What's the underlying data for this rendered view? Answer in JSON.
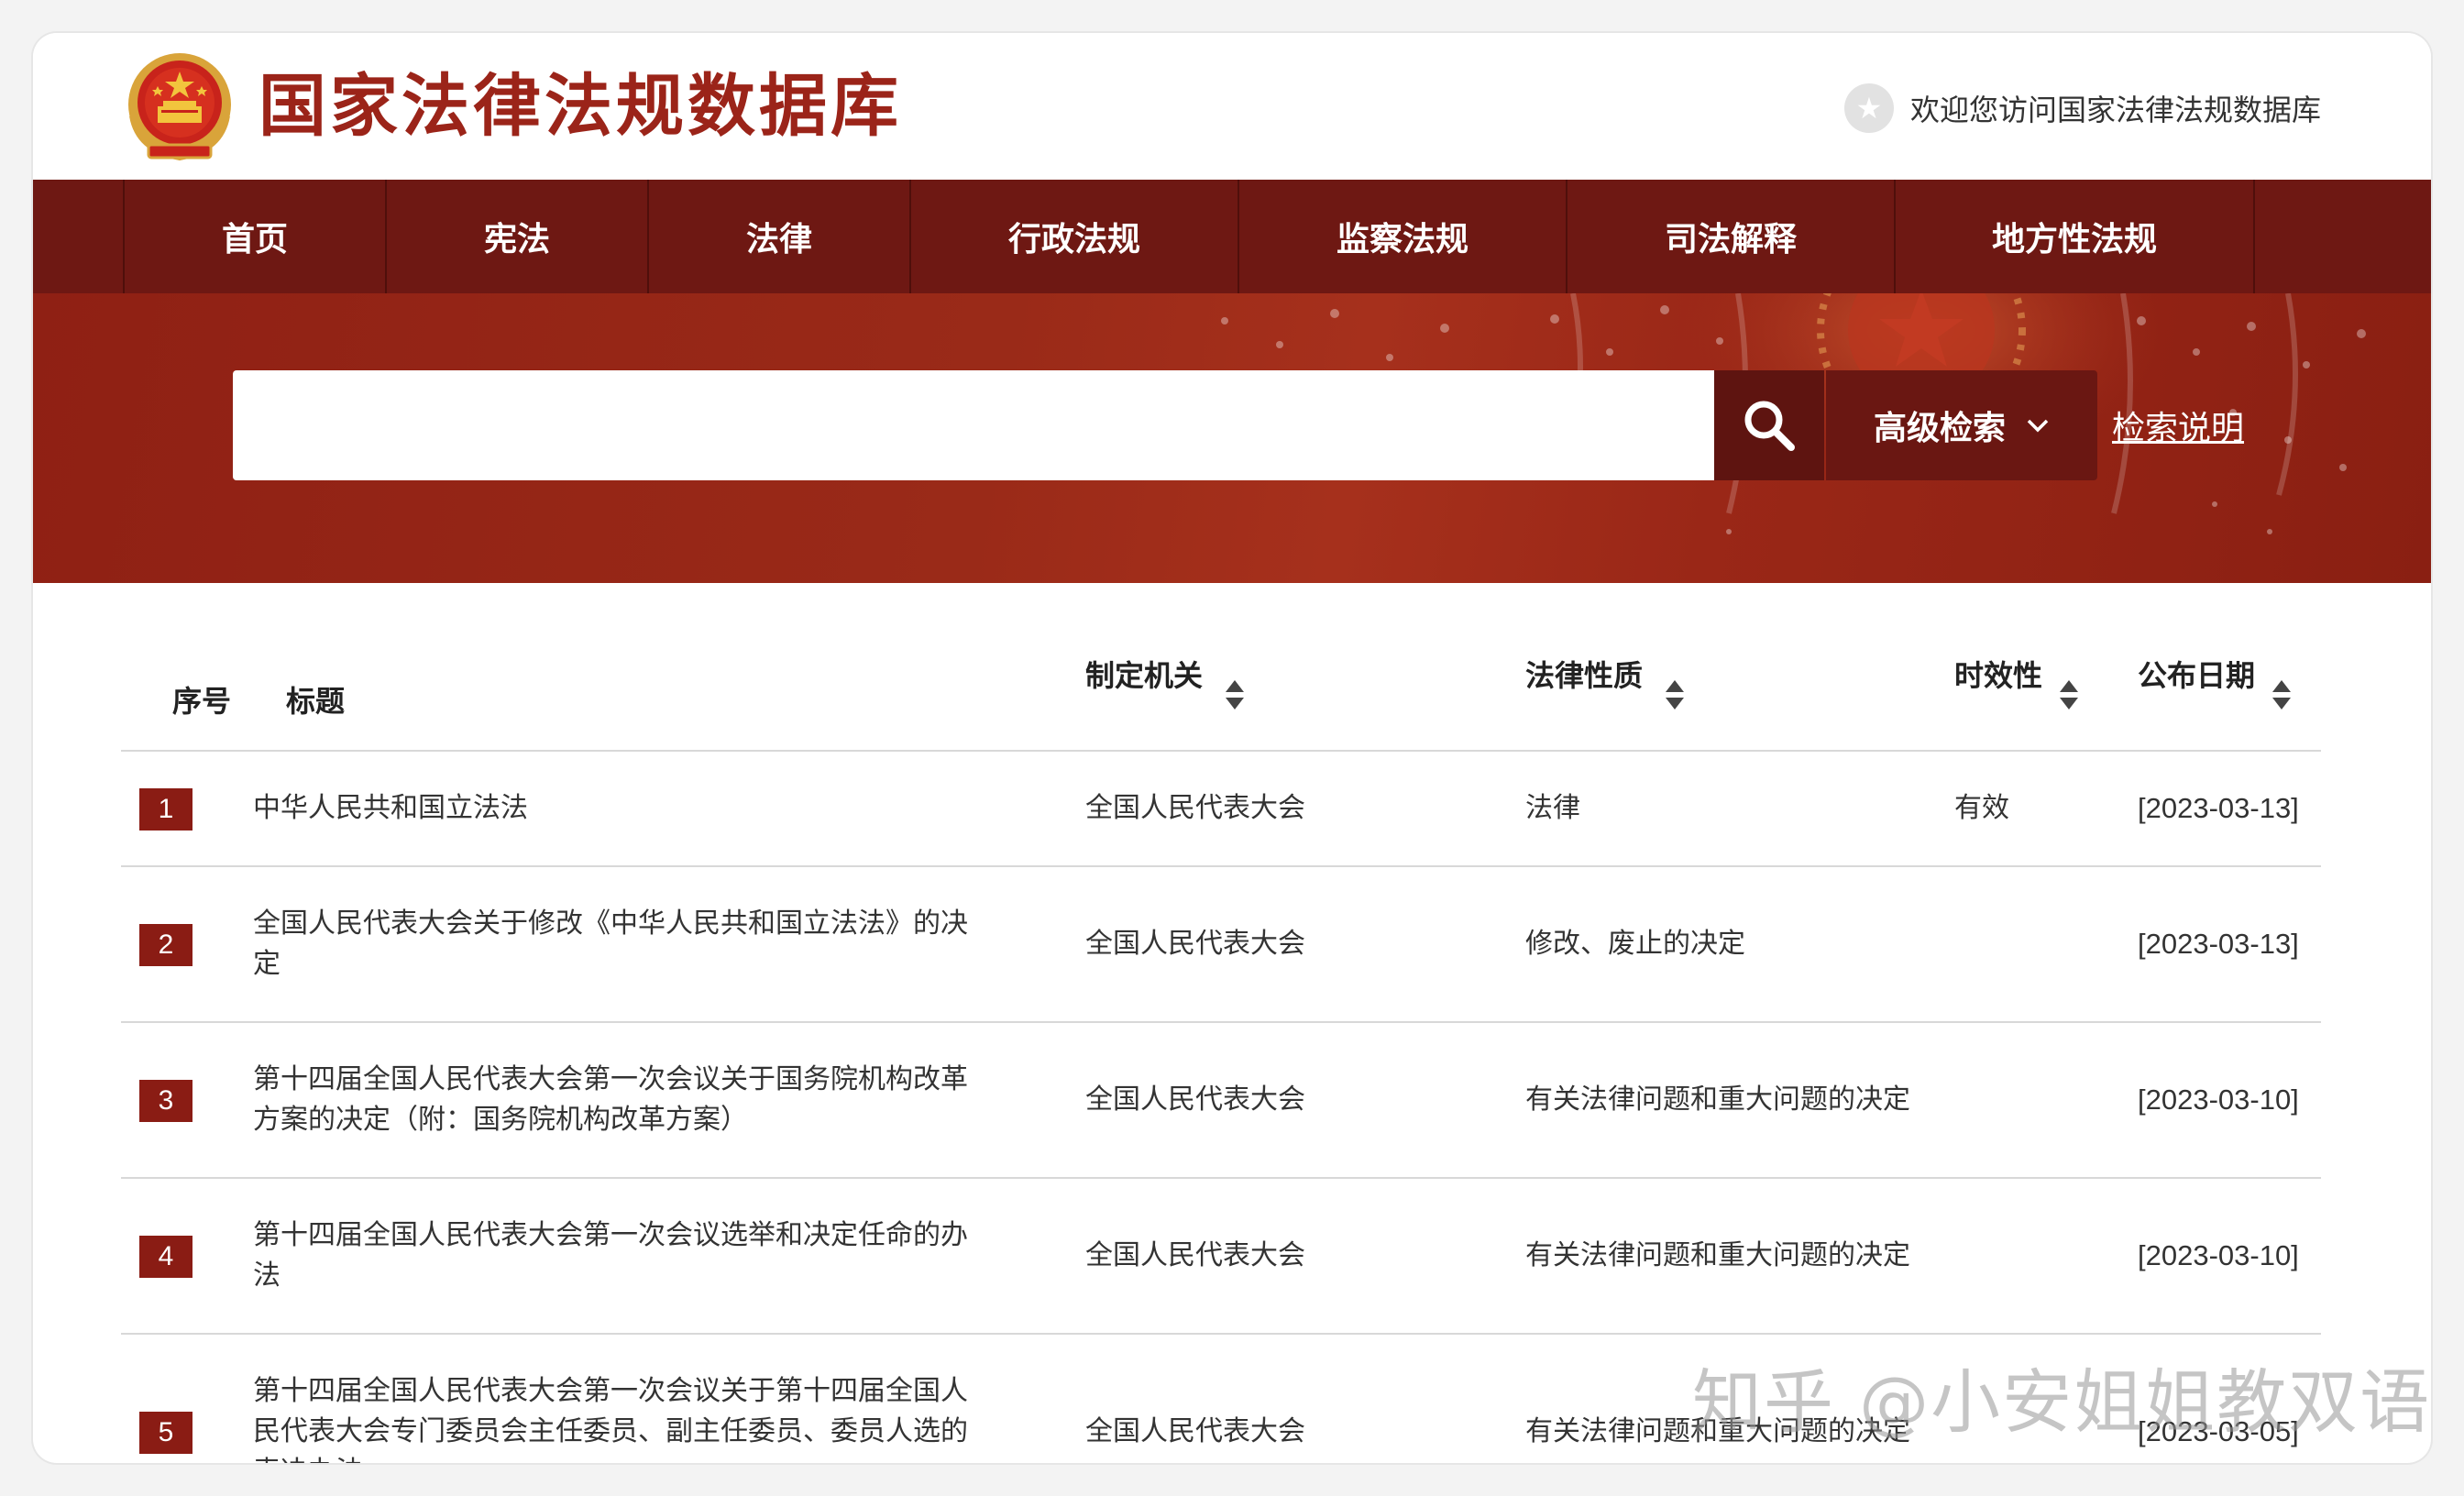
{
  "header": {
    "site_title": "国家法律法规数据库",
    "welcome_text": "欢迎您访问国家法律法规数据库",
    "emblem_icon": "national-emblem-icon"
  },
  "nav": {
    "items": [
      {
        "label": "首页"
      },
      {
        "label": "宪法"
      },
      {
        "label": "法律"
      },
      {
        "label": "行政法规"
      },
      {
        "label": "监察法规"
      },
      {
        "label": "司法解释"
      },
      {
        "label": "地方性法规"
      }
    ]
  },
  "search": {
    "value": "",
    "placeholder": "",
    "advanced_label": "高级检索",
    "help_label": "检索说明"
  },
  "table": {
    "columns": {
      "index": "序号",
      "title": "标题",
      "org": "制定机关",
      "nature": "法律性质",
      "validity": "时效性",
      "date": "公布日期"
    },
    "rows": [
      {
        "index": "1",
        "title": "中华人民共和国立法法",
        "org": "全国人民代表大会",
        "nature": "法律",
        "validity": "有效",
        "date": "[2023-03-13]"
      },
      {
        "index": "2",
        "title": "全国人民代表大会关于修改《中华人民共和国立法法》的决定",
        "org": "全国人民代表大会",
        "nature": "修改、废止的决定",
        "validity": "",
        "date": "[2023-03-13]"
      },
      {
        "index": "3",
        "title": "第十四届全国人民代表大会第一次会议关于国务院机构改革方案的决定（附：国务院机构改革方案）",
        "org": "全国人民代表大会",
        "nature": "有关法律问题和重大问题的决定",
        "validity": "",
        "date": "[2023-03-10]"
      },
      {
        "index": "4",
        "title": "第十四届全国人民代表大会第一次会议选举和决定任命的办法",
        "org": "全国人民代表大会",
        "nature": "有关法律问题和重大问题的决定",
        "validity": "",
        "date": "[2023-03-10]"
      },
      {
        "index": "5",
        "title": "第十四届全国人民代表大会第一次会议关于第十四届全国人民代表大会专门委员会主任委员、副主任委员、委员人选的表决办法",
        "org": "全国人民代表大会",
        "nature": "有关法律问题和重大问题的决定",
        "validity": "",
        "date": "[2023-03-05]"
      }
    ]
  },
  "watermark": "知乎 @小安姐姐教双语",
  "colors": {
    "brand_red": "#9b2419",
    "nav_dark_red": "#6e1813",
    "index_badge": "#8a1c14"
  }
}
